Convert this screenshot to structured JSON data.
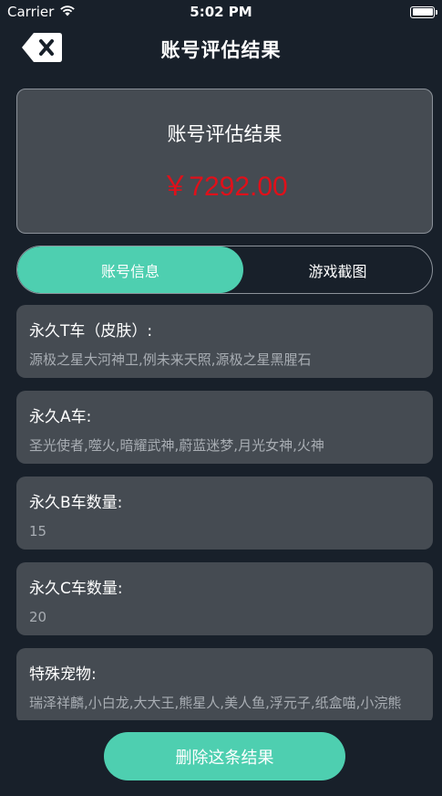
{
  "status_bar": {
    "carrier": "Carrier",
    "time": "5:02 PM",
    "wifi_icon": "wifi-icon",
    "battery_icon": "battery-icon"
  },
  "nav": {
    "title": "账号评估结果",
    "back_icon": "backspace-icon"
  },
  "result": {
    "title": "账号评估结果",
    "price": "￥7292.00",
    "price_color": "#e0101a"
  },
  "tabs": [
    {
      "label": "账号信息",
      "active": true
    },
    {
      "label": "游戏截图",
      "active": false
    }
  ],
  "info": [
    {
      "label": "永久T车（皮肤）:",
      "value": "源极之星大河神卫,例未来天照,源极之星黑腥石"
    },
    {
      "label": "永久A车:",
      "value": "圣光使者,噬火,暗耀武神,蔚蓝迷梦,月光女神,火神"
    },
    {
      "label": "永久B车数量:",
      "value": "15"
    },
    {
      "label": "永久C车数量:",
      "value": "20"
    },
    {
      "label": "特殊宠物:",
      "value": "瑞泽祥麟,小白龙,大大王,熊星人,美人鱼,浮元子,纸盒喵,小浣熊"
    }
  ],
  "actions": {
    "delete_label": "删除这条结果"
  },
  "colors": {
    "background": "#18202a",
    "card": "#454b52",
    "accent": "#4ecfb0"
  }
}
